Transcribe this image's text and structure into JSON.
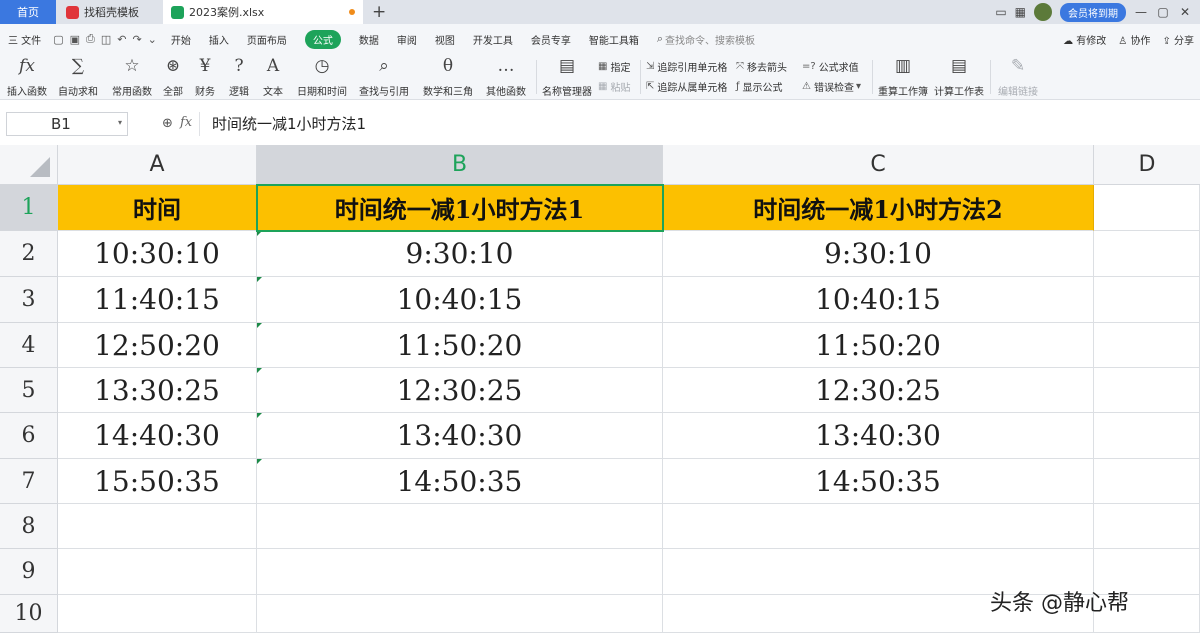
{
  "tabs": {
    "home": "首页",
    "template": "找稻壳模板",
    "file": "2023案例.xlsx",
    "add": "+"
  },
  "window": {
    "member_label": "会员将到期"
  },
  "menu": {
    "file": "三 文件",
    "items": [
      "开始",
      "插入",
      "页面布局",
      "公式",
      "数据",
      "审阅",
      "视图",
      "开发工具",
      "会员专享",
      "智能工具箱"
    ],
    "active": "公式",
    "search": "查找命令、搜索模板",
    "right": [
      "有修改",
      "协作",
      "分享"
    ]
  },
  "ribbon": {
    "insert_function": "插入函数",
    "autosum": "自动求和",
    "common_functions": "常用函数",
    "all": "全部",
    "finance": "财务",
    "logic": "逻辑",
    "text": "文本",
    "datetime": "日期和时间",
    "lookup": "查找与引用",
    "math": "数学和三角",
    "other": "其他函数",
    "name_manager": "名称管理器",
    "define": "指定",
    "paste": "粘贴",
    "trace_precedents": "追踪引用单元格",
    "trace_dependents": "追踪从属单元格",
    "remove_arrows": "移去箭头",
    "show_formulas": "显示公式",
    "evaluate": "公式求值",
    "error_check": "错误检查",
    "recalc_workbook": "重算工作簿",
    "calc_sheet": "计算工作表",
    "edit_links": "编辑链接"
  },
  "formula_bar": {
    "cell_ref": "B1",
    "content": "时间统一减1小时方法1"
  },
  "sheet": {
    "columns": [
      "A",
      "B",
      "C",
      "D"
    ],
    "rows": [
      "1",
      "2",
      "3",
      "4",
      "5",
      "6",
      "7",
      "8",
      "9",
      "10"
    ],
    "selected_column": "B",
    "selected_row": "1",
    "header": [
      "时间",
      "时间统一减1小时方法1",
      "时间统一减1小时方法2"
    ],
    "data": [
      [
        "10:30:10",
        "9:30:10",
        "9:30:10"
      ],
      [
        "11:40:15",
        "10:40:15",
        "10:40:15"
      ],
      [
        "12:50:20",
        "11:50:20",
        "11:50:20"
      ],
      [
        "13:30:25",
        "12:30:25",
        "12:30:25"
      ],
      [
        "14:40:30",
        "13:40:30",
        "13:40:30"
      ],
      [
        "15:50:35",
        "14:50:35",
        "14:50:35"
      ]
    ],
    "header_color": "#fcc000",
    "accent_color": "#1da35a"
  },
  "watermark": "头条 @静心帮"
}
